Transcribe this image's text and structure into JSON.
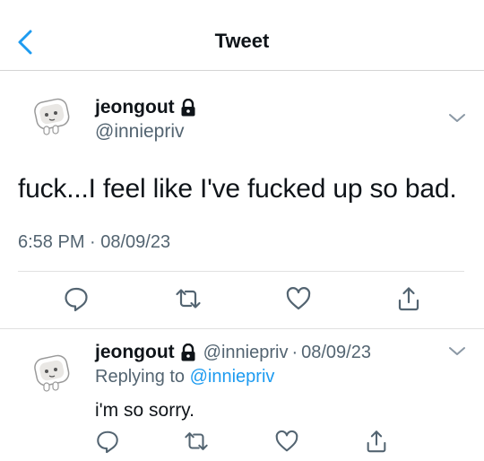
{
  "header": {
    "title": "Tweet",
    "back_icon": "chevron-left-icon"
  },
  "tweet": {
    "display_name": "jeongout",
    "handle": "@inniepriv",
    "text": "fuck...I feel like I've fucked up so bad.",
    "timestamp": "6:58 PM · 08/09/23",
    "actions": [
      "reply-icon",
      "retweet-icon",
      "like-icon",
      "share-icon"
    ]
  },
  "reply": {
    "display_name": "jeongout",
    "handle": "@inniepriv",
    "separator": "·",
    "date": "08/09/23",
    "replying_prefix": "Replying to",
    "replying_handle": "@inniepriv",
    "text": "i'm so sorry."
  },
  "colors": {
    "accent": "#1d9bf0",
    "secondary_text": "#536471",
    "icon": "#536471"
  }
}
